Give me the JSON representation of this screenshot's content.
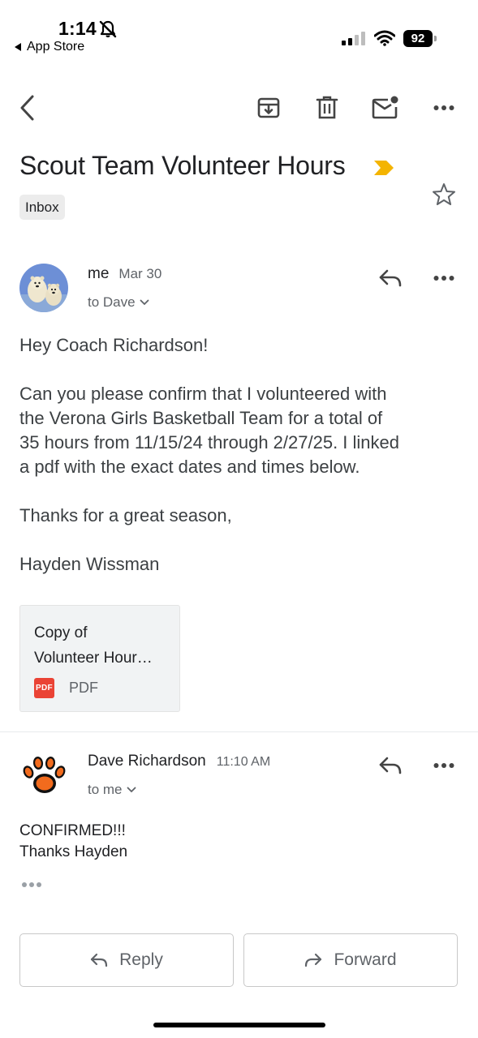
{
  "status_bar": {
    "time": "1:14",
    "back_app": "App Store",
    "battery": "92"
  },
  "toolbar": {
    "icons": [
      "back-arrow-icon",
      "archive-icon",
      "trash-icon",
      "mark-unread-icon",
      "more-icon"
    ]
  },
  "thread": {
    "subject": "Scout Team Volunteer Hours",
    "label": "Inbox",
    "importance_color": "#f4b400"
  },
  "message1": {
    "sender": "me",
    "date": "Mar 30",
    "to": "to Dave",
    "greeting": "Hey Coach Richardson!",
    "paragraph_lines": [
      "Can you please confirm that I volunteered with",
      "the Verona Girls Basketball Team for a total of",
      "35 hours from 11/15/24 through 2/27/25. I linked",
      "a pdf with the exact dates and times below."
    ],
    "closing": "Thanks for a great season,",
    "signature": "Hayden Wissman",
    "attachment": {
      "name_line1": "Copy of",
      "name_line2": "Volunteer Hour…",
      "badge": "PDF",
      "type": "PDF"
    }
  },
  "message2": {
    "sender": "Dave Richardson",
    "time": "11:10 AM",
    "to": "to me",
    "line1": "CONFIRMED!!!",
    "line2": "Thanks Hayden"
  },
  "actions": {
    "reply": "Reply",
    "forward": "Forward"
  },
  "colors": {
    "accent_red": "#ea4335",
    "text_secondary": "#5f6368"
  }
}
